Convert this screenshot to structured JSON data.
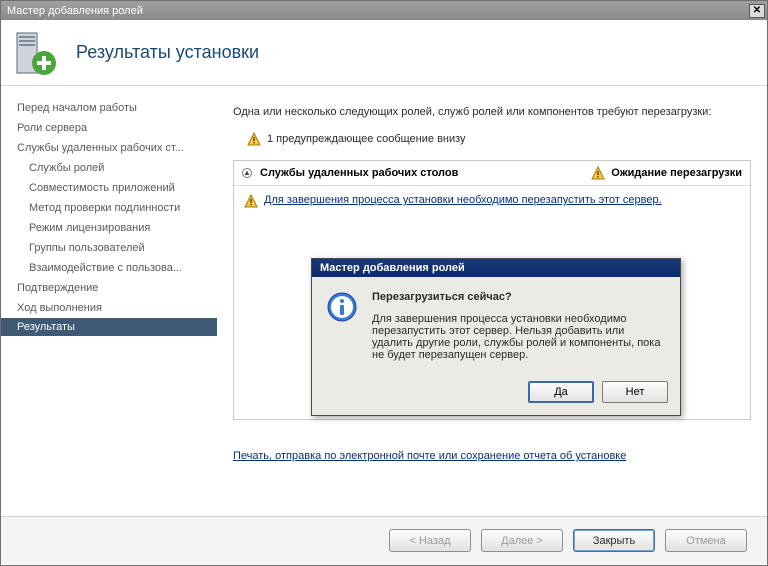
{
  "window": {
    "title": "Мастер добавления ролей",
    "header_title": "Результаты установки"
  },
  "sidebar": {
    "items": [
      {
        "label": "Перед началом работы",
        "sub": false
      },
      {
        "label": "Роли сервера",
        "sub": false
      },
      {
        "label": "Службы удаленных рабочих ст...",
        "sub": false
      },
      {
        "label": "Службы ролей",
        "sub": true
      },
      {
        "label": "Совместимость приложений",
        "sub": true
      },
      {
        "label": "Метод проверки подлинности",
        "sub": true
      },
      {
        "label": "Режим лицензирования",
        "sub": true
      },
      {
        "label": "Группы пользователей",
        "sub": true
      },
      {
        "label": "Взаимодействие с пользова...",
        "sub": true
      },
      {
        "label": "Подтверждение",
        "sub": false
      },
      {
        "label": "Ход выполнения",
        "sub": false
      },
      {
        "label": "Результаты",
        "sub": false,
        "active": true
      }
    ]
  },
  "main": {
    "intro": "Одна или несколько следующих ролей, служб ролей или компонентов требуют перезагрузки:",
    "warn_count_msg": "1 предупреждающее сообщение внизу",
    "result_role": "Службы удаленных рабочих столов",
    "result_status": "Ожидание перезагрузки",
    "result_detail": "Для завершения процесса установки необходимо перезапустить этот сервер.",
    "report_link": "Печать, отправка по электронной почте или сохранение отчета об установке"
  },
  "buttons": {
    "back": "< Назад",
    "next": "Далее >",
    "close": "Закрыть",
    "cancel": "Отмена"
  },
  "dialog": {
    "title": "Мастер добавления ролей",
    "heading": "Перезагрузиться сейчас?",
    "body": "Для завершения процесса установки необходимо перезапустить этот сервер. Нельзя добавить или удалить другие роли, службы ролей и компоненты, пока не будет перезапущен сервер.",
    "yes": "Да",
    "no": "Нет"
  }
}
